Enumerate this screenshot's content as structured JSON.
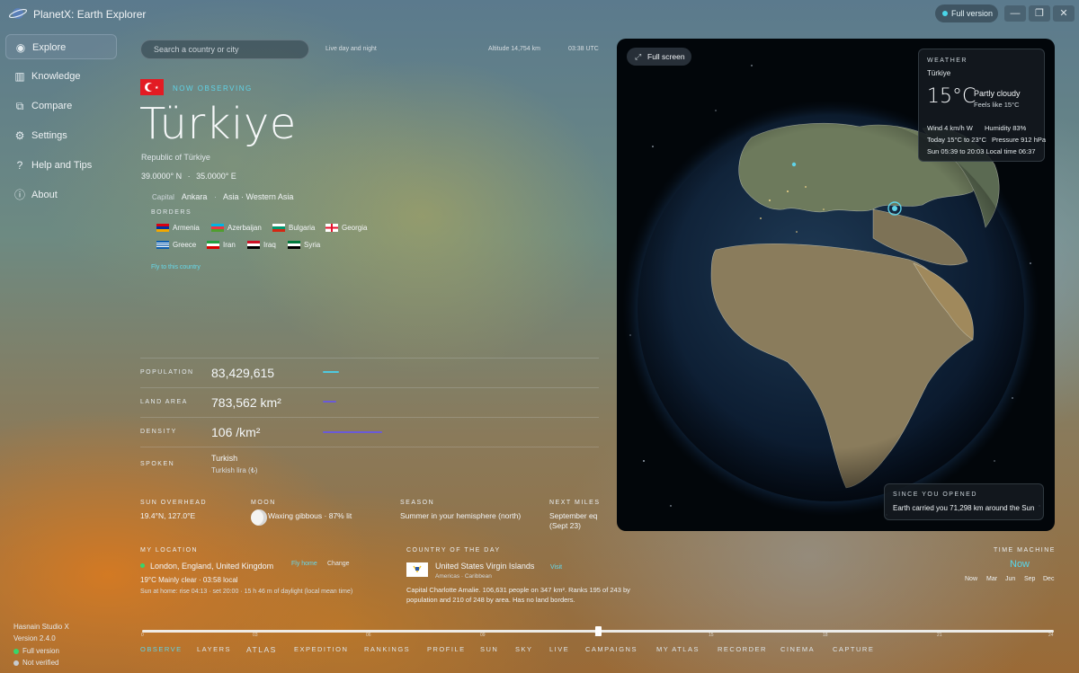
{
  "app": {
    "title": "PlanetX: Earth Explorer",
    "full_version_label": "Full version"
  },
  "window_controls": {
    "minimize": "—",
    "restore": "❐",
    "close": "✕"
  },
  "sidebar": {
    "items": [
      {
        "label": "Explore",
        "icon": "globe-icon",
        "glyph": "◉",
        "active": true
      },
      {
        "label": "Knowledge",
        "icon": "books-icon",
        "glyph": "▥"
      },
      {
        "label": "Compare",
        "icon": "compare-icon",
        "glyph": "⧉"
      },
      {
        "label": "Settings",
        "icon": "gear-icon",
        "glyph": "⚙"
      },
      {
        "label": "Help and Tips",
        "icon": "question-icon",
        "glyph": "?"
      },
      {
        "label": "About",
        "icon": "info-icon",
        "glyph": "ⓘ"
      }
    ],
    "footer": {
      "studio": "Hasnain Studio X",
      "version": "Version 2.4.0",
      "full_version": "Full version",
      "not_verified": "Not verified"
    }
  },
  "topbar": {
    "search_placeholder": "Search a country or city",
    "mode": "Live day and night",
    "altitude": "Altitude 14,754 km",
    "time": "03:38 UTC"
  },
  "country": {
    "status": "NOW OBSERVING",
    "name": "Türkiye",
    "official_name": "Republic of Türkiye",
    "lat": "39.0000° N",
    "lon": "35.0000° E",
    "capital_label": "Capital",
    "capital": "Ankara",
    "region": "Asia · Western Asia",
    "borders_label": "BORDERS",
    "borders": [
      "Armenia",
      "Azerbaijan",
      "Bulgaria",
      "Georgia",
      "Greece",
      "Iran",
      "Iraq",
      "Syria"
    ],
    "fly_label": "Fly to this country"
  },
  "stats": {
    "population_label": "POPULATION",
    "population": "83,429,615",
    "population_bar": 0.035,
    "land_area_label": "LAND AREA",
    "land_area": "783,562 km²",
    "land_area_bar": 0.03,
    "density_label": "DENSITY",
    "density": "106 /km²",
    "density_bar": 0.13,
    "spoken_label": "SPOKEN",
    "language": "Turkish",
    "currency": "Turkish lira (₺)"
  },
  "sky": {
    "sun_label": "SUN OVERHEAD",
    "sun_value": "19.4°N, 127.0°E",
    "moon_label": "MOON",
    "moon_value": "Waxing gibbous · 87% lit",
    "season_label": "SEASON",
    "season_value": "Summer in your hemisphere (north)",
    "next_label": "NEXT MILES",
    "next_value": "September eq",
    "next_value2": "(Sept 23)"
  },
  "my_location": {
    "label": "MY LOCATION",
    "city": "London, England, United Kingdom",
    "fly_home": "Fly home",
    "change": "Change",
    "weather": "19°C Mainly clear · 03:58 local",
    "sun": "Sun at home: rise 04:13 · set 20:00 · 15 h 46 m of daylight (local mean time)"
  },
  "country_of_day": {
    "label": "COUNTRY OF THE DAY",
    "name": "United States Virgin Islands",
    "visit": "Visit",
    "region": "Americas · Caribbean",
    "desc": "Capital Charlotte Amalie. 106,631 people on 347 km². Ranks 195 of 243 by population and 210 of 248 by area. Has no land borders."
  },
  "time_machine": {
    "label": "TIME MACHINE",
    "now": "Now",
    "months": [
      "Now",
      "Mar",
      "Jun",
      "Sep",
      "Dec"
    ]
  },
  "timeline": {
    "position": 0.5,
    "ticks": [
      "0",
      "03",
      "06",
      "09",
      "12",
      "15",
      "18",
      "21",
      "24"
    ]
  },
  "tabs": [
    "OBSERVE",
    "LAYERS",
    "ATLAS",
    "EXPEDITION",
    "RANKINGS",
    "PROFILE",
    "SUN",
    "SKY",
    "LIVE",
    "CAMPAIGNS",
    "MY ATLAS",
    "RECORDER",
    "CINEMA",
    "CAPTURE"
  ],
  "globe": {
    "fullscreen_label": "Full screen",
    "weather": {
      "label": "WEATHER",
      "country": "Türkiye",
      "temp": "15°C",
      "condition": "Partly cloudy",
      "feels": "Feels like 15°C",
      "wind": "Wind 4 km/h W",
      "humidity": "Humidity 83%",
      "range": "Today 15°C to 23°C",
      "pressure": "Pressure 912 hPa",
      "sun": "Sun 05:39 to 20:03 Local time 06:37"
    },
    "since_label": "SINCE YOU OPENED",
    "since_text": "Earth carried you 71,298 km around the Sun"
  },
  "colors": {
    "accent": "#5fd3e8",
    "bar_cyan": "#4fc9e0",
    "bar_violet": "#6a5ad8",
    "status_green": "#36d66b"
  }
}
